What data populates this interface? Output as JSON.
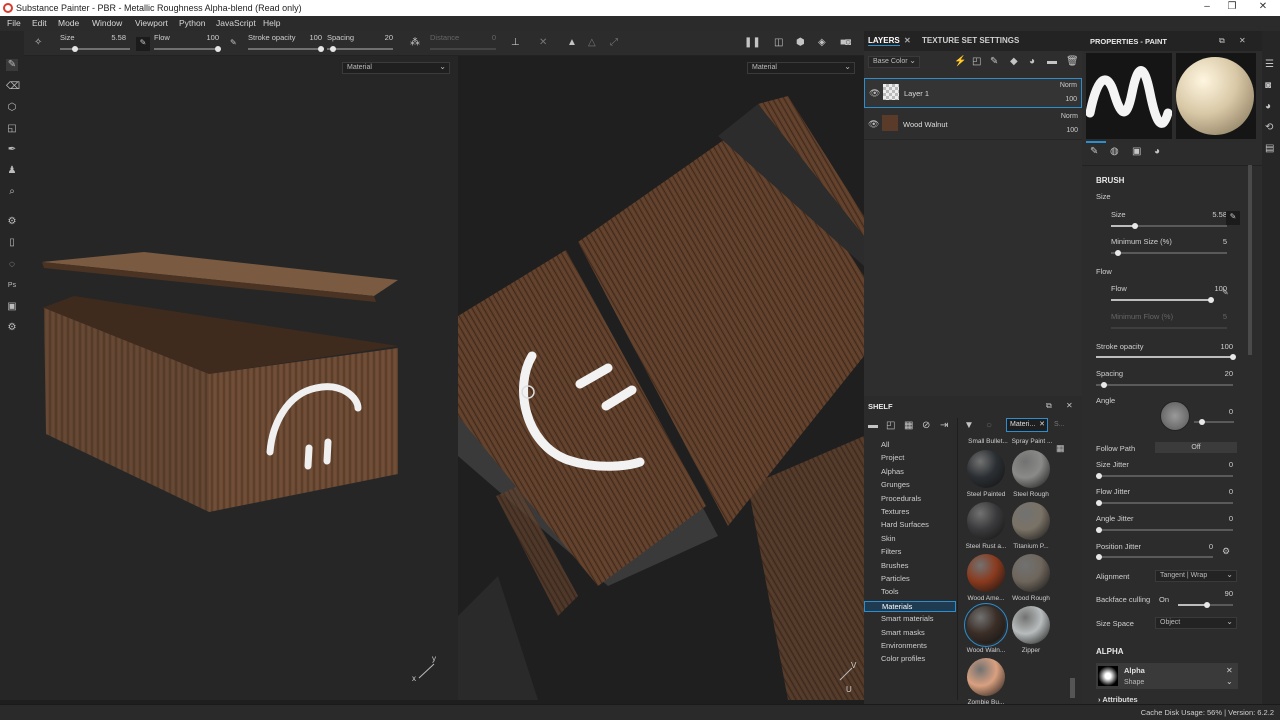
{
  "window": {
    "title": "Substance Painter - PBR - Metallic Roughness Alpha-blend (Read only)"
  },
  "menu": [
    "File",
    "Edit",
    "Mode",
    "Window",
    "Viewport",
    "Python",
    "JavaScript",
    "Help"
  ],
  "toolbar": {
    "size_label": "Size",
    "size_value": "5.58",
    "flow_label": "Flow",
    "flow_value": "100",
    "stroke_opacity_label": "Stroke opacity",
    "stroke_opacity_value": "100",
    "spacing_label": "Spacing",
    "spacing_value": "20",
    "distance_label": "Distance",
    "distance_value": "0"
  },
  "viewports": {
    "left_channel": "Material",
    "right_channel": "Material"
  },
  "layers": {
    "tab_layers": "LAYERS",
    "tab_texture_set": "TEXTURE SET SETTINGS",
    "channel": "Base Color",
    "items": [
      {
        "name": "Layer 1",
        "blend": "Norm",
        "opacity": "100"
      },
      {
        "name": "Wood Walnut",
        "blend": "Norm",
        "opacity": "100"
      }
    ]
  },
  "shelf": {
    "title": "SHELF",
    "filter_tag": "Materi...",
    "search_placeholder": "S...",
    "categories": [
      "All",
      "Project",
      "Alphas",
      "Grunges",
      "Procedurals",
      "Textures",
      "Hard Surfaces",
      "Skin",
      "Filters",
      "Brushes",
      "Particles",
      "Tools",
      "Materials",
      "Smart materials",
      "Smart masks",
      "Environments",
      "Color profiles"
    ],
    "selected_category": "Materials",
    "materials_top_partial": [
      "Small Bullet...",
      "Spray Paint ..."
    ],
    "materials": [
      {
        "name": "Steel Painted",
        "color": "#2b2f33"
      },
      {
        "name": "Steel Rough",
        "color": "#8a8a88"
      },
      {
        "name": "Steel Rust a...",
        "color": "#3a3a3c"
      },
      {
        "name": "Titanium P...",
        "color": "#7a7266"
      },
      {
        "name": "Wood Ame...",
        "color": "#8a3a1e"
      },
      {
        "name": "Wood Rough",
        "color": "#6e665c"
      },
      {
        "name": "Wood Waln...",
        "color": "#3b2e27"
      },
      {
        "name": "Zipper",
        "color": "#b8bcbc"
      },
      {
        "name": "Zombie Bu...",
        "color": "#d9a080"
      }
    ]
  },
  "properties": {
    "title": "PROPERTIES - PAINT",
    "brush_section": "BRUSH",
    "size_group": "Size",
    "size_label": "Size",
    "size_value": "5.58",
    "min_size_label": "Minimum Size (%)",
    "min_size_value": "5",
    "flow_group": "Flow",
    "flow_label": "Flow",
    "flow_value": "100",
    "min_flow_label": "Minimum Flow (%)",
    "min_flow_value": "5",
    "stroke_opacity_label": "Stroke opacity",
    "stroke_opacity_value": "100",
    "spacing_label": "Spacing",
    "spacing_value": "20",
    "angle_label": "Angle",
    "angle_value": "0",
    "follow_path_label": "Follow Path",
    "follow_path_value": "Off",
    "size_jitter_label": "Size Jitter",
    "size_jitter_value": "0",
    "flow_jitter_label": "Flow Jitter",
    "flow_jitter_value": "0",
    "angle_jitter_label": "Angle Jitter",
    "angle_jitter_value": "0",
    "position_jitter_label": "Position Jitter",
    "position_jitter_value": "0",
    "alignment_label": "Alignment",
    "alignment_value": "Tangent | Wrap",
    "backface_label": "Backface culling",
    "backface_toggle": "On",
    "backface_value": "90",
    "size_space_label": "Size Space",
    "size_space_value": "Object",
    "alpha_section": "ALPHA",
    "alpha_name": "Alpha",
    "alpha_sub": "Shape",
    "attributes_label": "Attributes"
  },
  "status": {
    "text": "Cache Disk Usage:   56% | Version: 6.2.2"
  },
  "colors": {
    "accent": "#2d8ecf",
    "panel": "#2c2c2c",
    "viewport": "#262626"
  }
}
